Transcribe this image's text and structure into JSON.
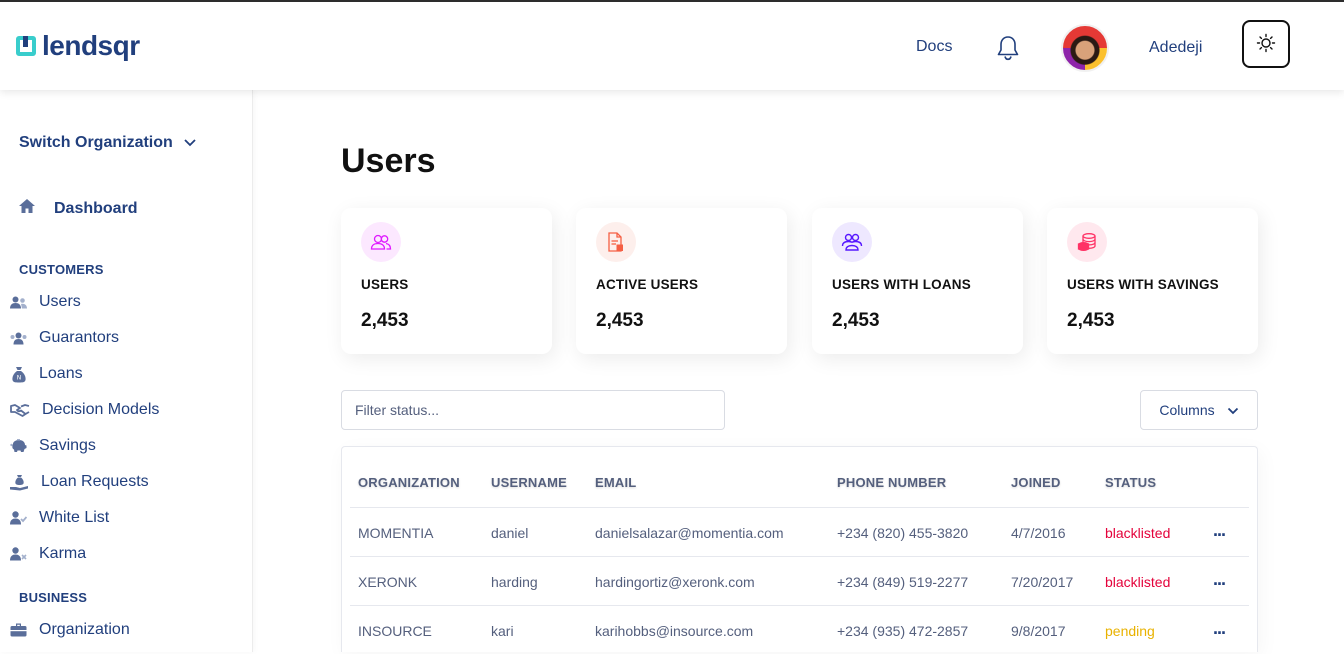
{
  "header": {
    "logo_text": "lendsqr",
    "docs_label": "Docs",
    "user_name": "Adedeji"
  },
  "sidebar": {
    "switch_org_label": "Switch Organization",
    "dashboard_label": "Dashboard",
    "customers_title": "CUSTOMERS",
    "customers_items": [
      {
        "label": "Users",
        "icon": "users-icon"
      },
      {
        "label": "Guarantors",
        "icon": "guarantors-icon"
      },
      {
        "label": "Loans",
        "icon": "loan-sack-icon"
      },
      {
        "label": "Decision Models",
        "icon": "handshake-icon"
      },
      {
        "label": "Savings",
        "icon": "piggy-bank-icon"
      },
      {
        "label": "Loan Requests",
        "icon": "loan-request-icon"
      },
      {
        "label": "White List",
        "icon": "user-check-icon"
      },
      {
        "label": "Karma",
        "icon": "user-x-icon"
      }
    ],
    "business_title": "BUSINESS",
    "business_items": [
      {
        "label": "Organization",
        "icon": "briefcase-icon"
      }
    ]
  },
  "main": {
    "title": "Users",
    "cards": [
      {
        "label": "USERS",
        "value": "2,453",
        "icon": "users-icon",
        "color": "#df18ff"
      },
      {
        "label": "ACTIVE USERS",
        "value": "2,453",
        "icon": "active-users-icon",
        "color": "#5718ff"
      },
      {
        "label": "USERS WITH LOANS",
        "value": "2,453",
        "icon": "loans-icon",
        "color": "#f55f44"
      },
      {
        "label": "USERS WITH SAVINGS",
        "value": "2,453",
        "icon": "savings-icon",
        "color": "#ff3366"
      }
    ],
    "filter_placeholder": "Filter status...",
    "columns_label": "Columns",
    "table": {
      "headers": [
        "ORGANIZATION",
        "USERNAME",
        "EMAIL",
        "PHONE NUMBER",
        "JOINED",
        "STATUS"
      ],
      "rows": [
        {
          "organization": "MOMENTIA",
          "username": "daniel",
          "email": "danielsalazar@momentia.com",
          "phone": "+234 (820) 455-3820",
          "joined": "4/7/2016",
          "status": "blacklisted"
        },
        {
          "organization": "XERONK",
          "username": "harding",
          "email": "hardingortiz@xeronk.com",
          "phone": "+234 (849) 519-2277",
          "joined": "7/20/2017",
          "status": "blacklisted"
        },
        {
          "organization": "INSOURCE",
          "username": "kari",
          "email": "karihobbs@insource.com",
          "phone": "+234 (935) 472-2857",
          "joined": "9/8/2017",
          "status": "pending"
        }
      ],
      "more_label": "..."
    }
  },
  "colors": {
    "primary": "#213f7d",
    "accent": "#39cdcc",
    "blacklisted": "#e4033b",
    "pending": "#e9b200"
  }
}
